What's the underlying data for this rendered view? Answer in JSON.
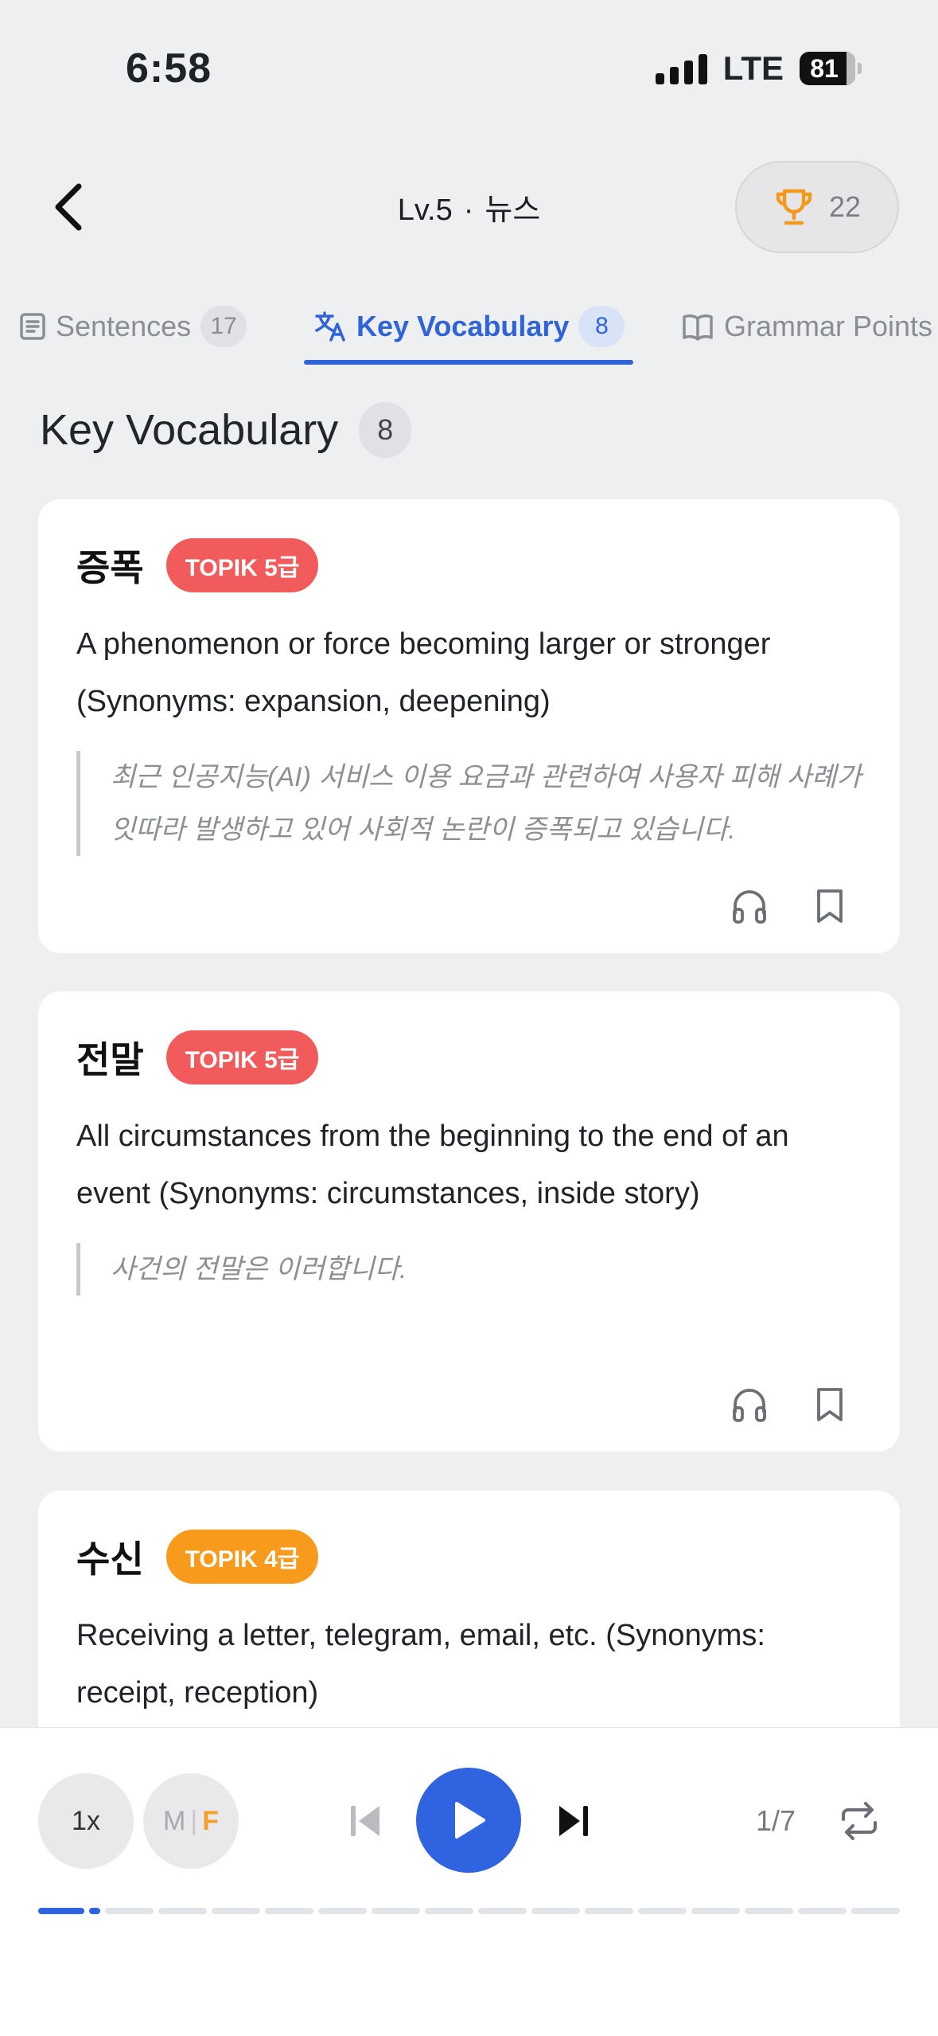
{
  "status": {
    "time": "6:58",
    "network": "LTE",
    "battery": "81"
  },
  "header": {
    "level": "Lv.5",
    "separator": "·",
    "category": "뉴스",
    "trophy_count": "22"
  },
  "tabs": [
    {
      "label": "Sentences",
      "count": "17"
    },
    {
      "label": "Key Vocabulary",
      "count": "8"
    },
    {
      "label": "Grammar Points",
      "count": ""
    }
  ],
  "section": {
    "title": "Key Vocabulary",
    "count": "8"
  },
  "vocab": [
    {
      "word": "증폭",
      "level": "TOPIK 5급",
      "level_color": "#f25b5b",
      "definition": "A phenomenon or force becoming larger or stronger (Synonyms: expansion, deepening)",
      "example": "최근 인공지능(AI) 서비스 이용 요금과 관련하여 사용자 피해 사례가 잇따라 발생하고 있어 사회적 논란이 증폭되고 있습니다."
    },
    {
      "word": "전말",
      "level": "TOPIK 5급",
      "level_color": "#f25b5b",
      "definition": "All circumstances from the beginning to the end of an event (Synonyms: circumstances, inside story)",
      "example": "사건의 전말은 이러합니다."
    },
    {
      "word": "수신",
      "level": "TOPIK 4급",
      "level_color": "#f89a1c",
      "definition": "Receiving a letter, telegram, email, etc. (Synonyms: receipt, reception)",
      "example": ""
    }
  ],
  "player": {
    "speed": "1x",
    "voice_m": "M",
    "voice_sep": "|",
    "voice_f": "F",
    "page": "1/7",
    "progress_segments": 17,
    "progress_current": 1
  },
  "icons": {
    "back": "chevron-left-icon",
    "trophy": "trophy-icon",
    "sentences": "document-icon",
    "vocabulary": "translate-icon",
    "grammar": "book-icon",
    "listen": "headphones-icon",
    "bookmark": "bookmark-icon",
    "prev": "skip-back-icon",
    "play": "play-icon",
    "next": "skip-forward-icon",
    "repeat": "repeat-icon"
  },
  "colors": {
    "accent": "#2f63e0",
    "trophy": "#f29a1d",
    "topik5": "#f25b5b",
    "topik4": "#f89a1c"
  }
}
